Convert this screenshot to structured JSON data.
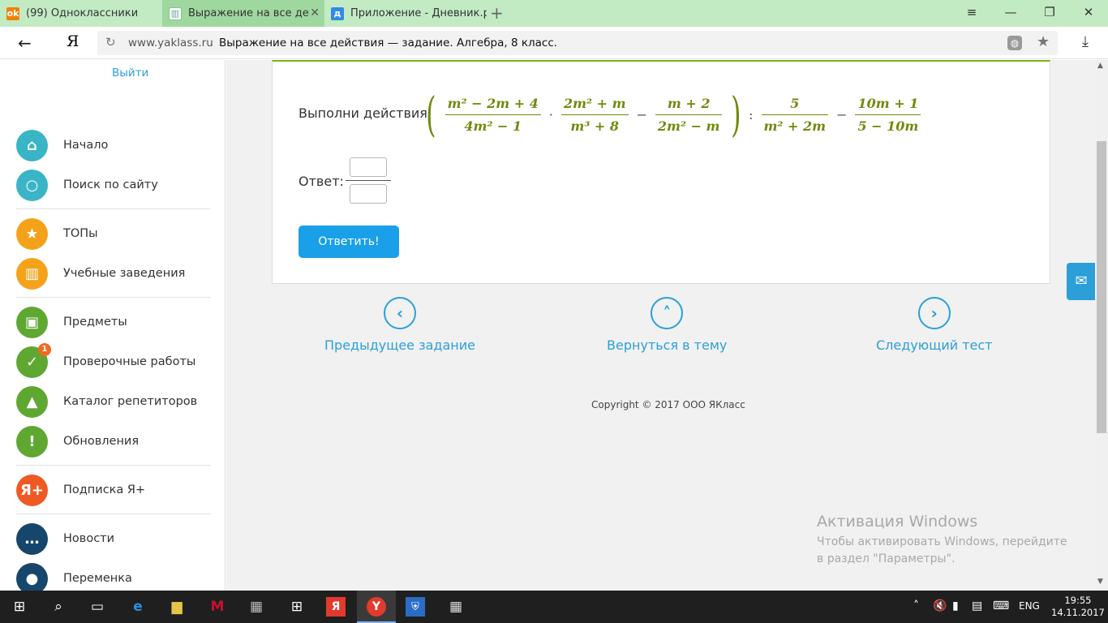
{
  "browser": {
    "tabs": [
      {
        "title": "(99) Одноклассники",
        "favicon": "ok-icon",
        "favicon_color": "#ee8208",
        "active": false
      },
      {
        "title": "Выражение на все дейст",
        "favicon": "book-icon",
        "favicon_color": "#ffffff",
        "active": true
      },
      {
        "title": "Приложение - Дневник.ру",
        "favicon": "dnevnik-icon",
        "favicon_color": "#2e8be8",
        "active": false
      }
    ],
    "new_tab": "+",
    "address": {
      "domain": "www.yaklass.ru",
      "title": "Выражение на все действия — задание. Алгебра, 8 класс."
    },
    "logo": "Я"
  },
  "sidebar": {
    "logout": "Выйти",
    "items": [
      {
        "label": "Начало",
        "icon": "home-icon",
        "color": "#3ab5c6",
        "glyph": "⌂"
      },
      {
        "label": "Поиск по сайту",
        "icon": "search-icon",
        "color": "#3ab5c6",
        "glyph": "○"
      },
      {
        "label": "ТОПы",
        "icon": "star-icon",
        "color": "#f5a21b",
        "glyph": "★"
      },
      {
        "label": "Учебные заведения",
        "icon": "building-icon",
        "color": "#f5a21b",
        "glyph": "▥"
      },
      {
        "label": "Предметы",
        "icon": "book-icon",
        "color": "#5ea832",
        "glyph": "▣"
      },
      {
        "label": "Проверочные работы",
        "icon": "check-icon",
        "color": "#5ea832",
        "glyph": "✓",
        "badge": "1"
      },
      {
        "label": "Каталог репетиторов",
        "icon": "graduation-cap-icon",
        "color": "#5ea832",
        "glyph": "▲"
      },
      {
        "label": "Обновления",
        "icon": "exclamation-icon",
        "color": "#5ea832",
        "glyph": "!"
      },
      {
        "label": "Подписка Я+",
        "icon": "ya-plus-icon",
        "color": "#ef5a24",
        "glyph": "Я+"
      },
      {
        "label": "Новости",
        "icon": "chat-icon",
        "color": "#16466c",
        "glyph": "…"
      },
      {
        "label": "Переменка",
        "icon": "bell-icon",
        "color": "#16466c",
        "glyph": "●"
      }
    ]
  },
  "task": {
    "prompt": "Выполни действия",
    "formula": {
      "f1_num": "m² − 2m + 4",
      "f1_den": "4m² − 1",
      "f2_num": "2m² + m",
      "f2_den": "m³ + 8",
      "f3_num": "m + 2",
      "f3_den": "2m² − m",
      "f4_num": "5",
      "f4_den": "m² + 2m",
      "f5_num": "10m + 1",
      "f5_den": "5 − 10m",
      "op_mul": "·",
      "op_minus": "−",
      "op_div": ":",
      "lparen": "(",
      "rparen": ")"
    },
    "answer_label": "Ответ:",
    "submit": "Ответить!"
  },
  "nav": {
    "prev": "Предыдущее задание",
    "back": "Вернуться в тему",
    "next": "Следующий тест"
  },
  "copyright": "Copyright © 2017 ООО ЯКласс",
  "activation": {
    "title": "Активация Windows",
    "text": "Чтобы активировать Windows, перейдите в раздел \"Параметры\"."
  },
  "taskbar": {
    "lang": "ENG",
    "time": "19:55",
    "date": "14.11.2017"
  },
  "colors": {
    "formula": "#6f8a0c",
    "link": "#2c9fd8",
    "submit": "#1aa0e8",
    "tabstrip": "#c3ebc3"
  }
}
